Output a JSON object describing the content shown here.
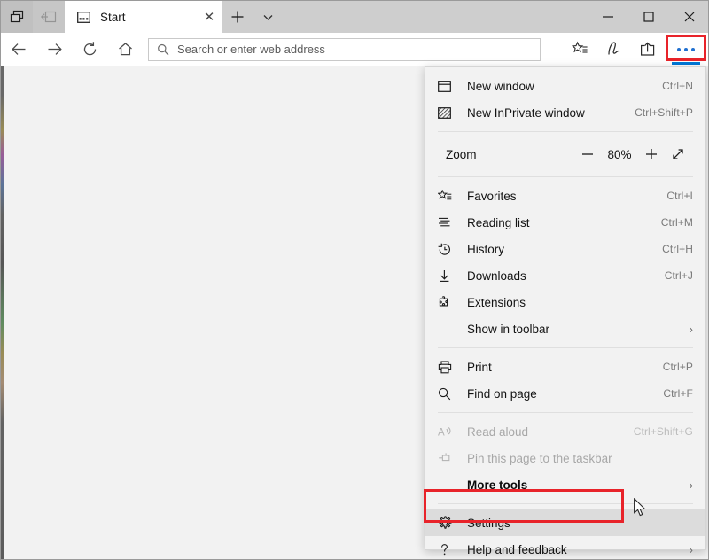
{
  "window": {
    "tab_aside_label": "set-tabs-aside",
    "tabs_aside_list_label": "tabs-you-have-set-aside",
    "minimize_label": "—",
    "maximize_label": "❐",
    "close_label": "✕"
  },
  "tabs": [
    {
      "title": "Start",
      "close_label": "✕",
      "favicon": "start-page-icon"
    }
  ],
  "tabbar": {
    "new_tab_label": "+",
    "tab_menu_label": "∨"
  },
  "toolbar": {
    "back_label": "←",
    "forward_label": "→",
    "refresh_label": "⟳",
    "home_label": "⌂",
    "favorites_label": "add-to-favorites",
    "notes_label": "add-notes",
    "share_label": "share",
    "more_label": "settings-and-more"
  },
  "address": {
    "placeholder": "Search or enter web address",
    "value": "",
    "search_icon": "search-icon"
  },
  "menu": {
    "items": [
      {
        "id": "new-window",
        "icon": "window-icon",
        "label": "New window",
        "accel": "Ctrl+N",
        "type": "item"
      },
      {
        "id": "new-inprivate-window",
        "icon": "inprivate-window-icon",
        "label": "New InPrivate window",
        "accel": "Ctrl+Shift+P",
        "type": "item"
      },
      {
        "type": "separator"
      },
      {
        "id": "zoom",
        "type": "zoom",
        "label": "Zoom",
        "value": "80%",
        "minus_label": "−",
        "plus_label": "+",
        "fullscreen_label": "fullscreen-icon"
      },
      {
        "type": "separator"
      },
      {
        "id": "favorites",
        "icon": "favorites-star-icon",
        "label": "Favorites",
        "accel": "Ctrl+I",
        "type": "item"
      },
      {
        "id": "reading-list",
        "icon": "reading-list-icon",
        "label": "Reading list",
        "accel": "Ctrl+M",
        "type": "item"
      },
      {
        "id": "history",
        "icon": "history-clock-icon",
        "label": "History",
        "accel": "Ctrl+H",
        "type": "item"
      },
      {
        "id": "downloads",
        "icon": "downloads-arrow-icon",
        "label": "Downloads",
        "accel": "Ctrl+J",
        "type": "item"
      },
      {
        "id": "extensions",
        "icon": "extensions-puzzle-icon",
        "label": "Extensions",
        "accel": "",
        "type": "item"
      },
      {
        "id": "show-in-toolbar",
        "icon": "",
        "label": "Show in toolbar",
        "accel": "",
        "submenu": "›",
        "type": "item"
      },
      {
        "type": "separator"
      },
      {
        "id": "print",
        "icon": "printer-icon",
        "label": "Print",
        "accel": "Ctrl+P",
        "type": "item"
      },
      {
        "id": "find-on-page",
        "icon": "magnifier-icon",
        "label": "Find on page",
        "accel": "Ctrl+F",
        "type": "item"
      },
      {
        "type": "separator"
      },
      {
        "id": "read-aloud",
        "icon": "read-aloud-icon",
        "label": "Read aloud",
        "accel": "Ctrl+Shift+G",
        "type": "item",
        "disabled": true
      },
      {
        "id": "pin-to-taskbar",
        "icon": "pin-icon",
        "label": "Pin this page to the taskbar",
        "accel": "",
        "type": "item",
        "disabled": true
      },
      {
        "id": "more-tools",
        "icon": "",
        "label": "More tools",
        "accel": "",
        "submenu": "›",
        "type": "item",
        "bold": true
      },
      {
        "type": "separator"
      },
      {
        "id": "settings",
        "icon": "gear-icon",
        "label": "Settings",
        "accel": "",
        "type": "item",
        "highlighted": true
      },
      {
        "id": "help-and-feedback",
        "icon": "question-mark-icon",
        "label": "Help and feedback",
        "accel": "",
        "submenu": "›",
        "type": "item"
      }
    ]
  },
  "annotations": {
    "highlight_color": "#e8232a",
    "accent_color": "#0078d7",
    "settings_highlight_target": "Settings",
    "more_button_highlight_target": "settings-and-more"
  }
}
